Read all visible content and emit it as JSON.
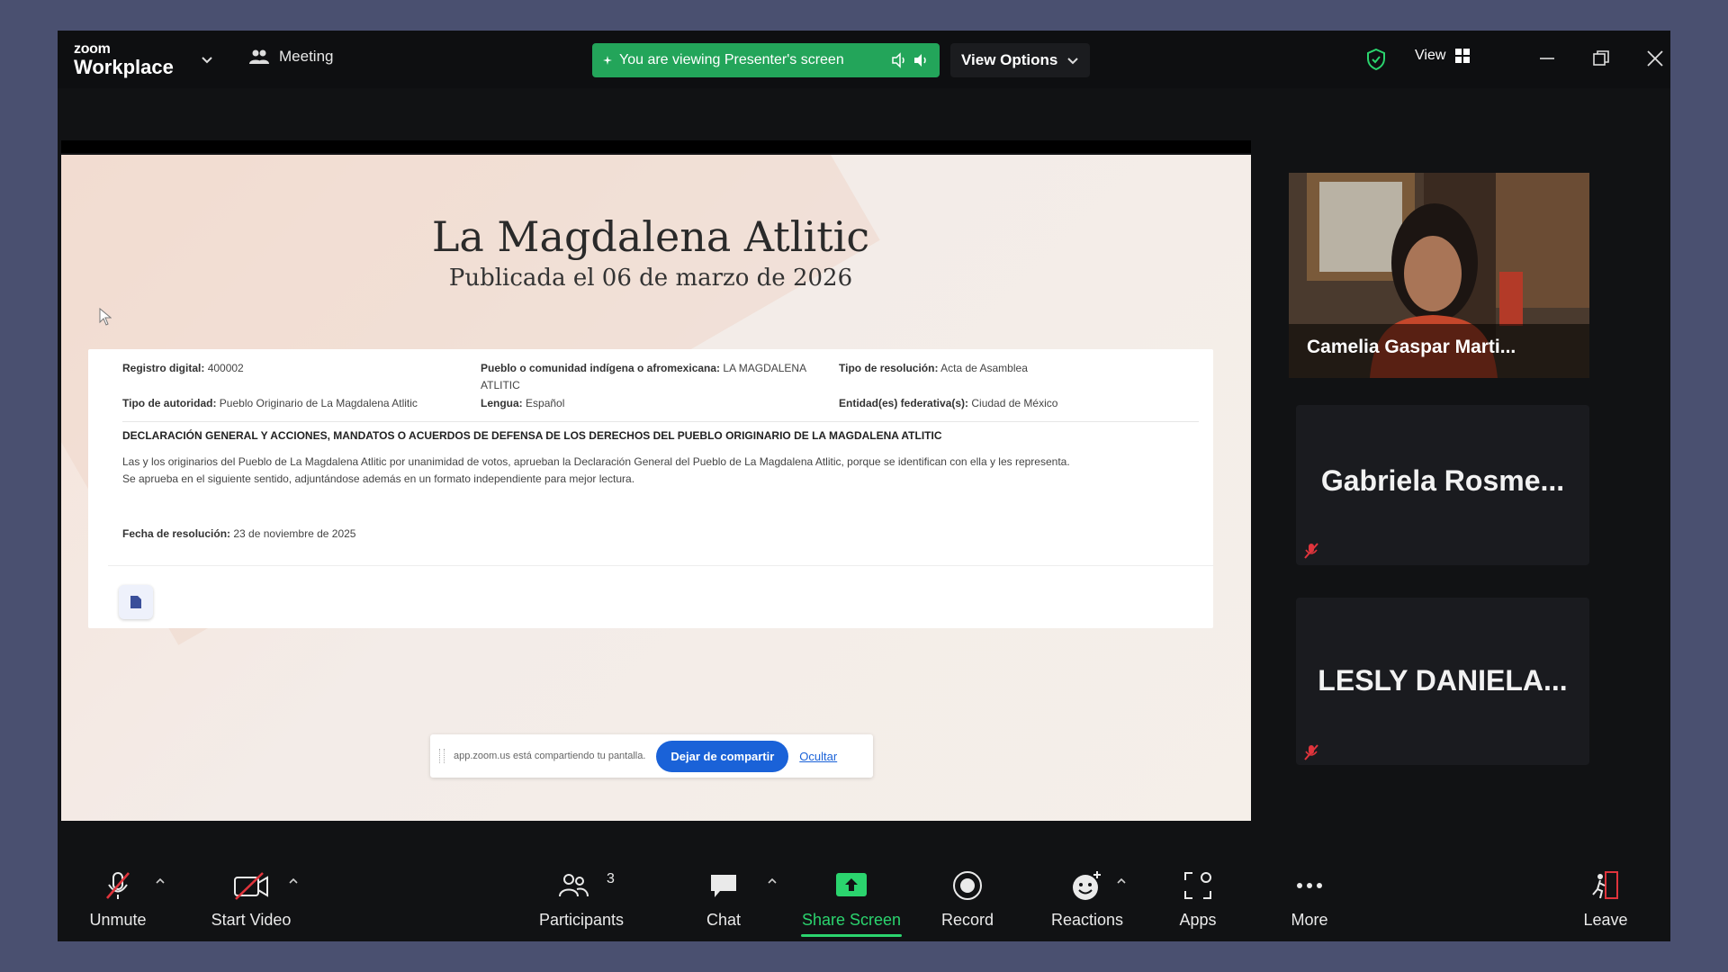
{
  "titlebar": {
    "brand_top": "zoom",
    "brand_bottom": "Workplace",
    "meeting_label": "Meeting",
    "viewing_text": "You are viewing Presenter's screen",
    "view_options": "View Options",
    "view_label": "View"
  },
  "shared_screen": {
    "title": "La Magdalena Atlitic",
    "subtitle": "Publicada el 06 de marzo de 2026",
    "fields": {
      "registro_label": "Registro digital:",
      "registro_value": "400002",
      "pueblo_label": "Pueblo o comunidad indígena o afromexicana:",
      "pueblo_value": "LA MAGDALENA",
      "pueblo_value_2": "ATLITIC",
      "tipo_resolucion_label": "Tipo de resolución:",
      "tipo_resolucion_value": "Acta de Asamblea",
      "tipo_autoridad_label": "Tipo de autoridad:",
      "tipo_autoridad_value": "Pueblo Originario de La Magdalena Atlitic",
      "lengua_label": "Lengua:",
      "lengua_value": "Español",
      "entidad_label": "Entidad(es) federativa(s):",
      "entidad_value": "Ciudad de México",
      "fecha_label": "Fecha de resolución:",
      "fecha_value": "23 de noviembre de 2025"
    },
    "declaration_title": "DECLARACIÓN GENERAL Y ACCIONES, MANDATOS O ACUERDOS DE DEFENSA DE LOS DERECHOS DEL PUEBLO ORIGINARIO DE LA MAGDALENA ATLITIC",
    "declaration_line1": "Las y los originarios del Pueblo de La Magdalena Atlitic por unanimidad de votos, aprueban la Declaración General del Pueblo de La Magdalena Atlitic, porque se identifican con ella y les representa.",
    "declaration_line2": "Se aprueba en el siguiente sentido, adjuntándose además en un formato independiente para mejor lectura.",
    "share_bar_text": "app.zoom.us está compartiendo tu pantalla.",
    "stop_share": "Dejar de compartir",
    "hide": "Ocultar"
  },
  "participants": [
    {
      "name": "Camelia Gaspar Marti..."
    },
    {
      "name": "Gabriela  Rosme..."
    },
    {
      "name": "LESLY  DANIELA..."
    }
  ],
  "toolbar": {
    "unmute": "Unmute",
    "start_video": "Start Video",
    "participants": "Participants",
    "participants_count": "3",
    "chat": "Chat",
    "share_screen": "Share Screen",
    "record": "Record",
    "reactions": "Reactions",
    "apps": "Apps",
    "more": "More",
    "leave": "Leave"
  },
  "colors": {
    "green_accent": "#23a55a",
    "share_active": "#2bd46e",
    "stop_share_blue": "#1a62d8",
    "mute_red": "#e0343c"
  }
}
